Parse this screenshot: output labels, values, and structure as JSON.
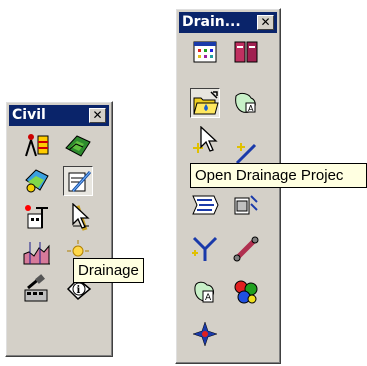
{
  "civil_palette": {
    "title": "Civil",
    "close_glyph": "✕",
    "tools": [
      "survey-tripod-icon",
      "terrain-model-icon",
      "geometry-icon",
      "drainage-icon",
      "site-building-icon",
      "roadway-icon",
      "cross-section-icon",
      "sun-effects-icon",
      "modeler-icon",
      "info-icon"
    ]
  },
  "drainage_palette": {
    "title": "Drain...",
    "close_glyph": "✕",
    "tools": [
      "drainage-options-icon",
      "drainage-library-icon",
      "open-drainage-project-icon",
      "area-icon",
      "node-sparkle-icon",
      "link-wand-icon",
      "profile-flow-icon",
      "layout-icon",
      "inlet-junction-icon",
      "pipe-icon",
      "area-text-icon",
      "components-icon",
      "navigator-icon"
    ]
  },
  "tooltips": {
    "drainage": "Drainage",
    "open_project": "Open Drainage Projec"
  },
  "colors": {
    "title_bar": "#0a246a",
    "face": "#d4d0c8",
    "tooltip_bg": "#ffffe1"
  }
}
